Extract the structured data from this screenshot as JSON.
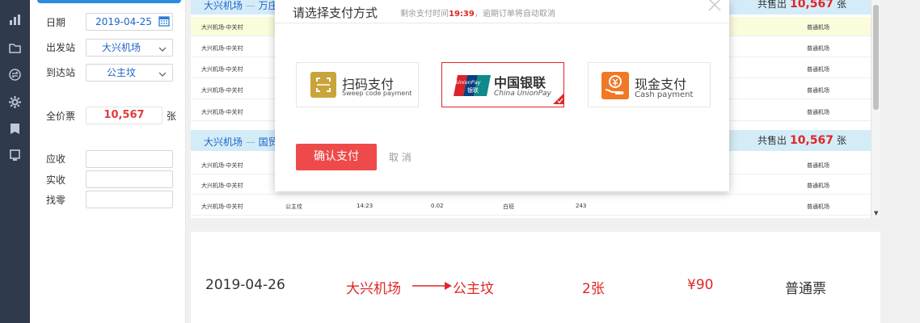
{
  "form": {
    "date_label": "日期",
    "date_value": "2019-04-25",
    "from_label": "出发站",
    "from_value": "大兴机场",
    "to_label": "到达站",
    "to_value": "公主坟",
    "fullprice_label": "全价票",
    "fullprice_value": "10,567",
    "fullprice_unit": "张",
    "receivable_label": "应收",
    "received_label": "实收",
    "change_label": "找零"
  },
  "groups": [
    {
      "title": "大兴机场",
      "dash": "—",
      "dest": "万庄",
      "sold_label": "共售出",
      "sold_count": "10,567",
      "sold_unit": "张"
    },
    {
      "title": "大兴机场",
      "dash": "—",
      "dest": "国贸",
      "sold_label": "共售出",
      "sold_count": "10,567",
      "sold_unit": "张"
    }
  ],
  "rows": [
    {
      "route": "大兴机场-中关村",
      "type": "普通机场"
    },
    {
      "route": "大兴机场-中关村",
      "type": "普通机场"
    },
    {
      "route": "大兴机场-中关村",
      "type": "普通机场"
    },
    {
      "route": "大兴机场-中关村",
      "type": "普通机场"
    },
    {
      "route": "大兴机场-中关村",
      "type": "普通机场"
    },
    {
      "route": "大兴机场-中关村",
      "type": "普通机场"
    },
    {
      "route": "大兴机场-中关村",
      "type": "普通机场"
    },
    {
      "route": "大兴机场-中关村",
      "dest": "公主坟",
      "time": "14:23",
      "val": "0.02",
      "shift": "白班",
      "num": "243",
      "type": "普通机场"
    }
  ],
  "summary": {
    "date": "2019-04-26",
    "from": "大兴机场",
    "to": "公主坟",
    "count": "2张",
    "price": "¥90",
    "ticket_type": "普通票"
  },
  "modal": {
    "title": "请选择支付方式",
    "hint_prefix": "剩余支付时间",
    "hint_time": "19:39",
    "hint_suffix": "，逾期订单将自动取消",
    "options": [
      {
        "title": "扫码支付",
        "subtitle": "Sweep code payment",
        "icon": "scan-icon"
      },
      {
        "title": "中国银联",
        "subtitle": "China UnionPay",
        "logo": "UnionPay",
        "logo_sub": "银联",
        "icon": "unionpay-logo"
      },
      {
        "title": "现金支付",
        "subtitle": "Cash payment",
        "icon": "cash-icon"
      }
    ],
    "confirm_label": "确认支付",
    "cancel_label": "取 消"
  },
  "colors": {
    "accent_red": "#e02626",
    "brand_blue": "#1f63c9",
    "nav_bg": "#2f3a4d",
    "group_header_bg": "#d4ecf8"
  }
}
